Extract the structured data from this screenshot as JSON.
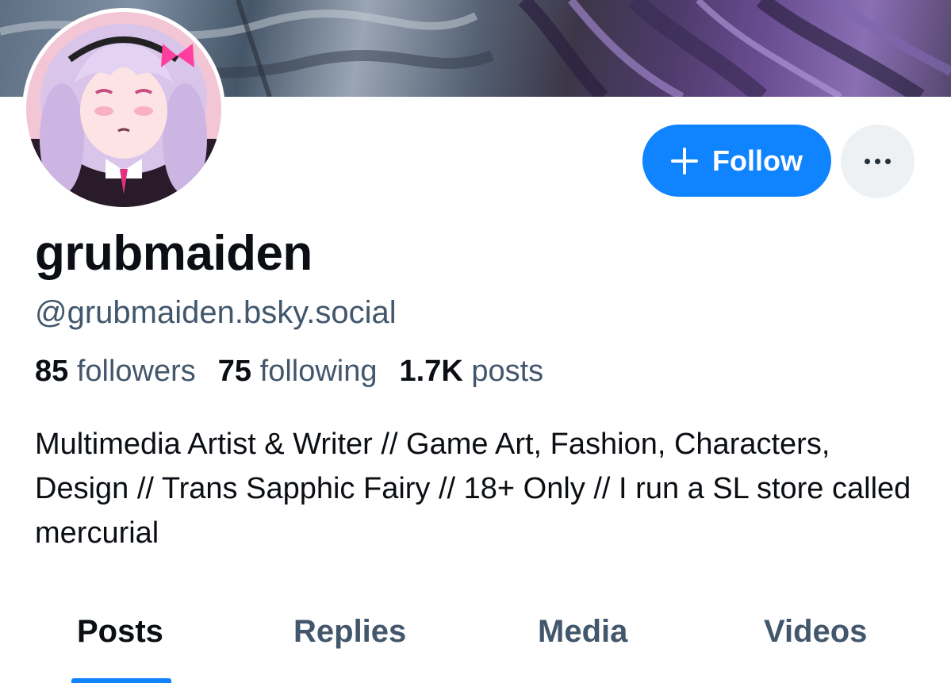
{
  "profile": {
    "display_name": "grubmaiden",
    "handle": "@grubmaiden.bsky.social",
    "bio": "Multimedia Artist & Writer // Game Art, Fashion, Characters, Design // Trans Sapphic Fairy // 18+ Only // I run a SL store called mercurial"
  },
  "stats": {
    "followers_count": "85",
    "followers_label": "followers",
    "following_count": "75",
    "following_label": "following",
    "posts_count": "1.7K",
    "posts_label": "posts"
  },
  "actions": {
    "follow_label": "Follow"
  },
  "tabs": [
    {
      "label": "Posts",
      "active": true
    },
    {
      "label": "Replies",
      "active": false
    },
    {
      "label": "Media",
      "active": false
    },
    {
      "label": "Videos",
      "active": false
    }
  ],
  "colors": {
    "accent": "#1083fe",
    "secondary_text": "#42576c",
    "primary_text": "#0b0f14"
  }
}
